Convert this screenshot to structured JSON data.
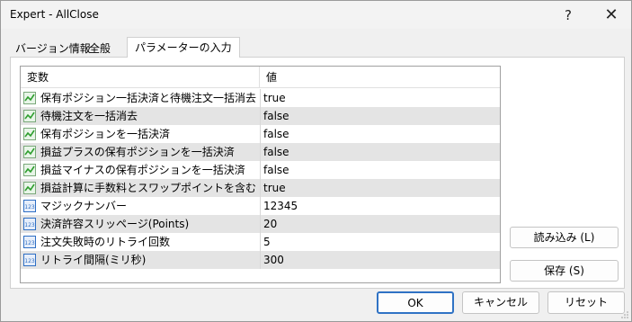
{
  "window": {
    "title": "Expert - AllClose",
    "help_glyph": "?",
    "close_glyph": "✕"
  },
  "tabs": [
    {
      "label": "バージョン情報",
      "active": false
    },
    {
      "label": "全般",
      "active": false
    },
    {
      "label": "パラメーターの入力",
      "active": true
    }
  ],
  "grid": {
    "header": {
      "variable": "変数",
      "value": "値"
    },
    "rows": [
      {
        "icon": "bool-icon",
        "name": "保有ポジション一括決済と待機注文一括消去",
        "value": "true"
      },
      {
        "icon": "bool-icon",
        "name": "待機注文を一括消去",
        "value": "false"
      },
      {
        "icon": "bool-icon",
        "name": "保有ポジションを一括決済",
        "value": "false"
      },
      {
        "icon": "bool-icon",
        "name": "損益プラスの保有ポジションを一括決済",
        "value": "false"
      },
      {
        "icon": "bool-icon",
        "name": "損益マイナスの保有ポジションを一括決済",
        "value": "false"
      },
      {
        "icon": "bool-icon",
        "name": "損益計算に手数料とスワップポイントを含む",
        "value": "true"
      },
      {
        "icon": "int-icon",
        "name": "マジックナンバー",
        "value": "12345"
      },
      {
        "icon": "int-icon",
        "name": "決済許容スリッページ(Points)",
        "value": "20"
      },
      {
        "icon": "int-icon",
        "name": "注文失敗時のリトライ回数",
        "value": "5"
      },
      {
        "icon": "int-icon",
        "name": "リトライ間隔(ミリ秒)",
        "value": "300"
      }
    ]
  },
  "side_buttons": {
    "load": "読み込み (L)",
    "save": "保存 (S)"
  },
  "footer": {
    "ok": "OK",
    "cancel": "キャンセル",
    "reset": "リセット"
  },
  "colors": {
    "accent": "#2f72c4",
    "bool_icon": "#2e9e2e",
    "int_icon": "#2f6fc4",
    "alt_row": "#e4e4e4"
  }
}
